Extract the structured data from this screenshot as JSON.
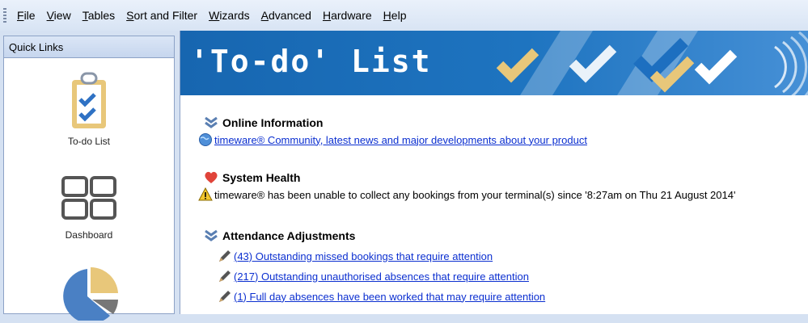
{
  "menu": {
    "items": [
      {
        "underline": "F",
        "rest": "ile"
      },
      {
        "underline": "V",
        "rest": "iew"
      },
      {
        "underline": "T",
        "rest": "ables"
      },
      {
        "underline": "S",
        "rest": "ort and Filter"
      },
      {
        "underline": "W",
        "rest": "izards"
      },
      {
        "underline": "A",
        "rest": "dvanced"
      },
      {
        "underline": "H",
        "rest": "ardware"
      },
      {
        "underline": "H",
        "rest": "elp"
      }
    ]
  },
  "sidebar": {
    "title": "Quick Links",
    "items": [
      {
        "label": "To-do List",
        "icon": "clipboard-check-icon"
      },
      {
        "label": "Dashboard",
        "icon": "dashboard-grid-icon"
      },
      {
        "label": "",
        "icon": "pie-chart-icon"
      }
    ]
  },
  "banner": {
    "title": "'To-do' List"
  },
  "sections": {
    "online": {
      "title": "Online Information",
      "link": "timeware® Community, latest news and major developments about your product"
    },
    "health": {
      "title": "System Health",
      "message": "timeware® has been unable to collect any bookings from your terminal(s) since '8:27am on Thu 21 August 2014'"
    },
    "attendance": {
      "title": "Attendance Adjustments",
      "links": [
        "(43) Outstanding missed bookings that require attention",
        "(217) Outstanding unauthorised absences that require attention",
        "(1) Full day absences have been worked that may require attention"
      ]
    }
  },
  "colors": {
    "banner": "#1e74c0",
    "check_gold": "#e7c06a",
    "check_blue": "#1d6fc0",
    "link": "#0b2fd0"
  }
}
